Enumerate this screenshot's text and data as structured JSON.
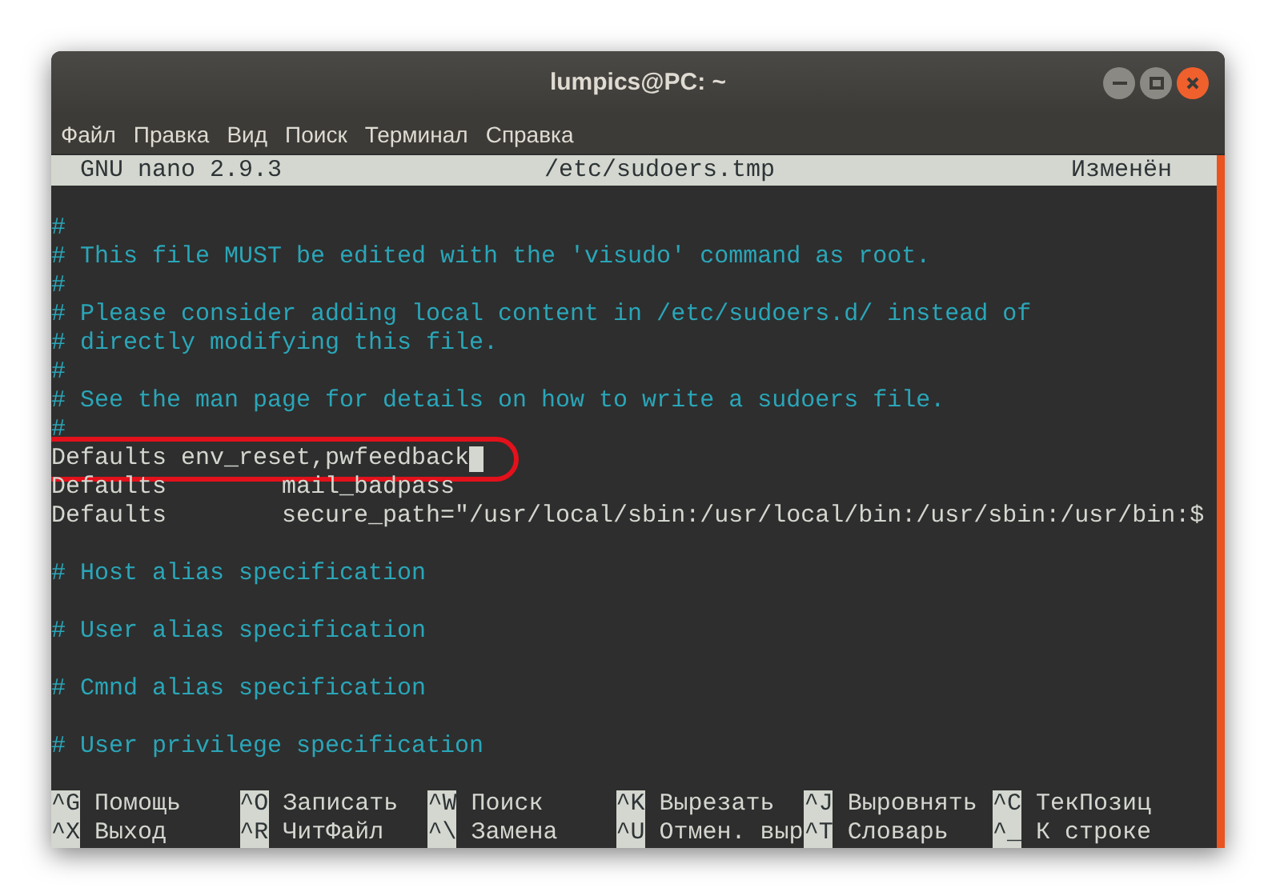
{
  "window": {
    "title": "lumpics@PC: ~"
  },
  "menu": [
    "Файл",
    "Правка",
    "Вид",
    "Поиск",
    "Терминал",
    "Справка"
  ],
  "header": {
    "version": "GNU nano 2.9.3",
    "file": "/etc/sudoers.tmp",
    "status": "Изменён"
  },
  "lines": [
    {
      "kind": "blank"
    },
    {
      "kind": "comment",
      "text": "#"
    },
    {
      "kind": "comment",
      "text": "# This file MUST be edited with the 'visudo' command as root."
    },
    {
      "kind": "comment",
      "text": "#"
    },
    {
      "kind": "comment",
      "text": "# Please consider adding local content in /etc/sudoers.d/ instead of"
    },
    {
      "kind": "comment",
      "text": "# directly modifying this file."
    },
    {
      "kind": "comment",
      "text": "#"
    },
    {
      "kind": "comment",
      "text": "# See the man page for details on how to write a sudoers file."
    },
    {
      "kind": "comment",
      "text": "#"
    },
    {
      "kind": "code",
      "text": "Defaults env_reset,pwfeedback",
      "highlighted": true,
      "cursor": true
    },
    {
      "kind": "code",
      "text": "Defaults        mail_badpass",
      "highlighted": false,
      "cursor": false
    },
    {
      "kind": "code",
      "text": "Defaults        secure_path=\"/usr/local/sbin:/usr/local/bin:/usr/sbin:/usr/bin:$",
      "highlighted": false,
      "cursor": false
    },
    {
      "kind": "blank"
    },
    {
      "kind": "comment",
      "text": "# Host alias specification"
    },
    {
      "kind": "blank"
    },
    {
      "kind": "comment",
      "text": "# User alias specification"
    },
    {
      "kind": "blank"
    },
    {
      "kind": "comment",
      "text": "# Cmnd alias specification"
    },
    {
      "kind": "blank"
    },
    {
      "kind": "comment",
      "text": "# User privilege specification"
    },
    {
      "kind": "blank"
    }
  ],
  "shortcuts": [
    [
      {
        "key": "^G",
        "label": "Помощь"
      },
      {
        "key": "^O",
        "label": "Записать"
      },
      {
        "key": "^W",
        "label": "Поиск"
      },
      {
        "key": "^K",
        "label": "Вырезать"
      },
      {
        "key": "^J",
        "label": "Выровнять"
      },
      {
        "key": "^C",
        "label": "ТекПозиц"
      }
    ],
    [
      {
        "key": "^X",
        "label": "Выход"
      },
      {
        "key": "^R",
        "label": "ЧитФайл"
      },
      {
        "key": "^\\",
        "label": "Замена"
      },
      {
        "key": "^U",
        "label": "Отмен. выр"
      },
      {
        "key": "^T",
        "label": "Словарь"
      },
      {
        "key": "^_",
        "label": "К строке"
      }
    ]
  ]
}
